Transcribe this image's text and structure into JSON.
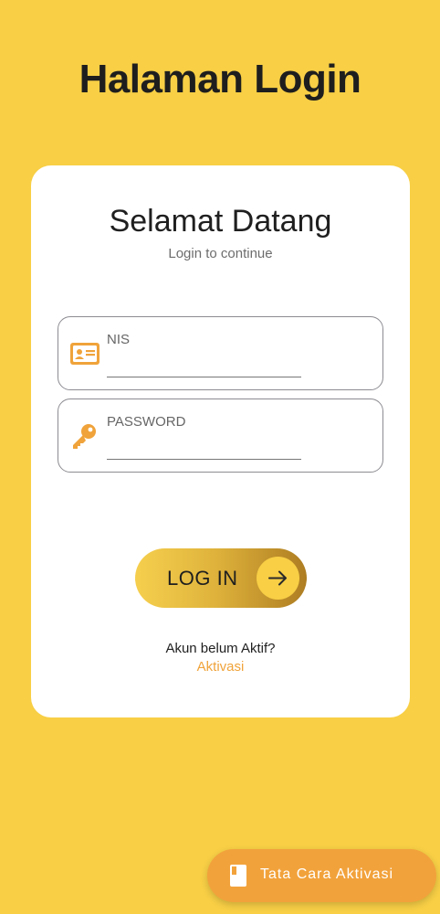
{
  "header": {
    "title": "Halaman Login"
  },
  "card": {
    "title": "Selamat Datang",
    "subtitle": "Login to continue"
  },
  "form": {
    "nis": {
      "label": "NIS",
      "value": "",
      "icon": "id-card-icon"
    },
    "password": {
      "label": "PASSWORD",
      "value": "",
      "icon": "key-icon"
    }
  },
  "login_button": {
    "label": "LOG IN",
    "icon": "arrow-right-icon"
  },
  "activation": {
    "prompt": "Akun belum Aktif?",
    "link": "Aktivasi"
  },
  "fab": {
    "label": "Tata Cara Aktivasi",
    "icon": "book-icon"
  },
  "colors": {
    "background": "#F8CF45",
    "accent": "#F0A33A",
    "card": "#FFFFFF"
  }
}
